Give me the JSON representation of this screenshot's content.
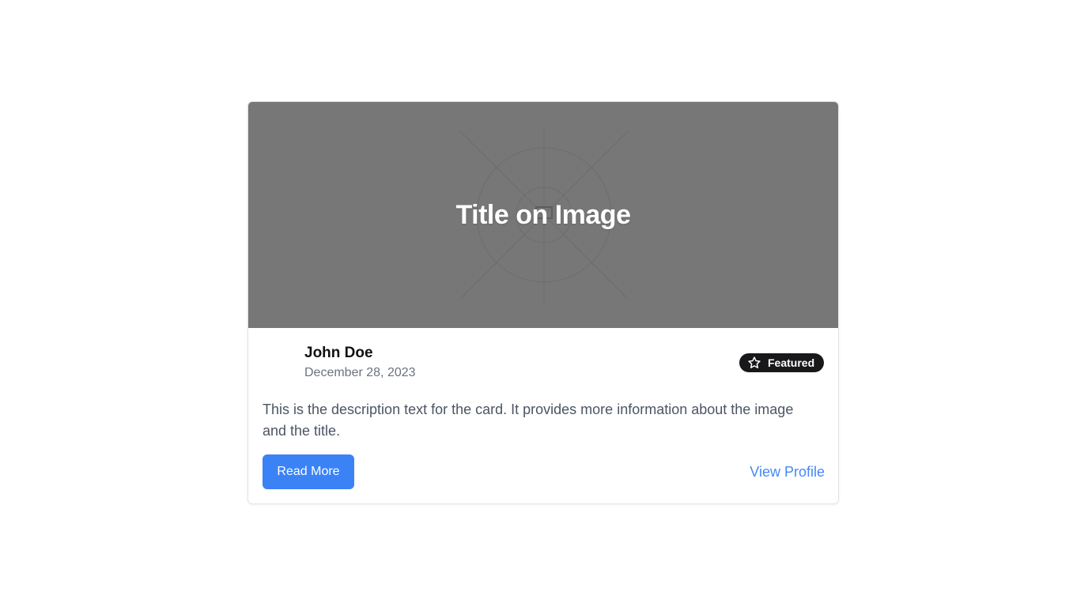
{
  "card": {
    "image": {
      "title": "Title on Image",
      "icon": "image-placeholder-icon",
      "background_color": "#777777"
    },
    "author": {
      "name": "John Doe",
      "date": "December 28, 2023"
    },
    "badge": {
      "label": "Featured",
      "icon": "star-icon",
      "background_color": "#18181b"
    },
    "description": "This is the description text for the card. It provides more information about the image and the title.",
    "actions": {
      "primary_label": "Read More",
      "secondary_label": "View Profile",
      "accent_color": "#3b82f6"
    }
  }
}
